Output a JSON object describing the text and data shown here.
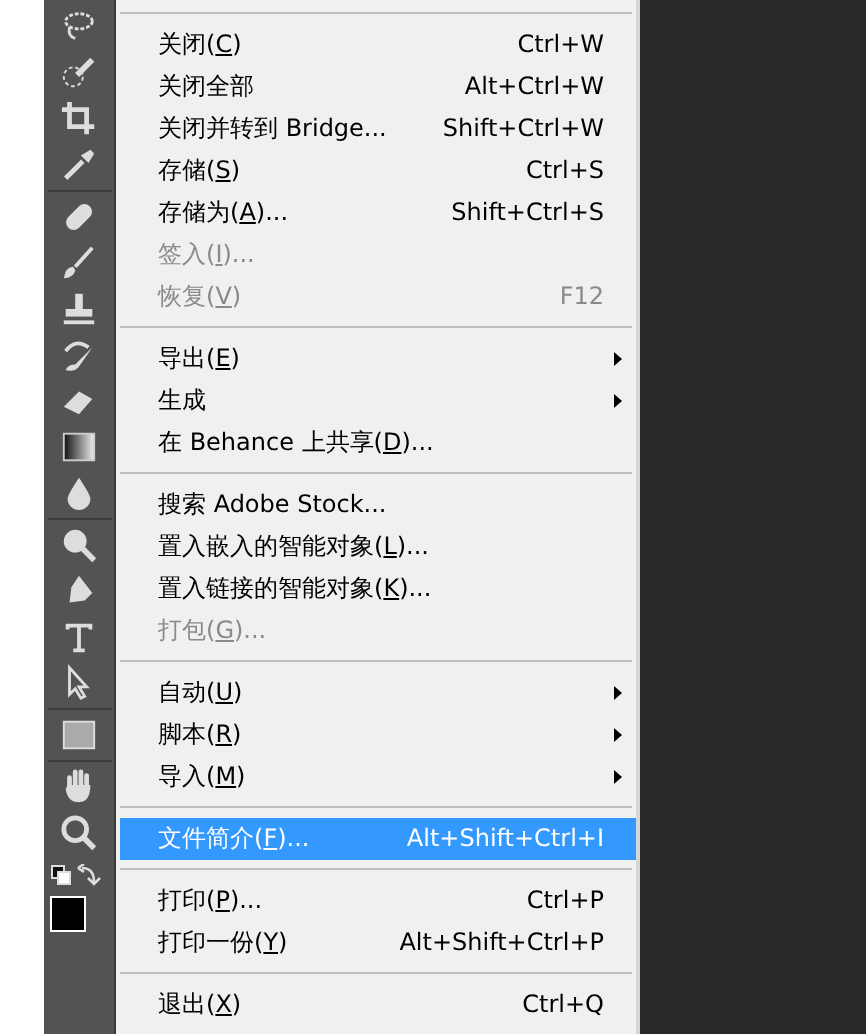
{
  "file_menu": {
    "items": [
      {
        "kind": "separator"
      },
      {
        "kind": "item",
        "parts": [
          "关闭(",
          "C",
          ")"
        ],
        "shortcut": "Ctrl+W",
        "disabled": false,
        "submenu": false,
        "selected": false
      },
      {
        "kind": "item",
        "parts": [
          "关闭全部"
        ],
        "shortcut": "Alt+Ctrl+W",
        "disabled": false,
        "submenu": false,
        "selected": false
      },
      {
        "kind": "item",
        "parts": [
          "关闭并转到 Bridge..."
        ],
        "shortcut": "Shift+Ctrl+W",
        "disabled": false,
        "submenu": false,
        "selected": false
      },
      {
        "kind": "item",
        "parts": [
          "存储(",
          "S",
          ")"
        ],
        "shortcut": "Ctrl+S",
        "disabled": false,
        "submenu": false,
        "selected": false
      },
      {
        "kind": "item",
        "parts": [
          "存储为(",
          "A",
          ")..."
        ],
        "shortcut": "Shift+Ctrl+S",
        "disabled": false,
        "submenu": false,
        "selected": false
      },
      {
        "kind": "item",
        "parts": [
          "签入(",
          "I",
          ")..."
        ],
        "disabled": true,
        "submenu": false,
        "selected": false
      },
      {
        "kind": "item",
        "parts": [
          "恢复(",
          "V",
          ")"
        ],
        "shortcut": "F12",
        "disabled": true,
        "submenu": false,
        "selected": false
      },
      {
        "kind": "separator"
      },
      {
        "kind": "item",
        "parts": [
          "导出(",
          "E",
          ")"
        ],
        "disabled": false,
        "submenu": true,
        "selected": false
      },
      {
        "kind": "item",
        "parts": [
          "生成"
        ],
        "disabled": false,
        "submenu": true,
        "selected": false
      },
      {
        "kind": "item",
        "parts": [
          "在 Behance 上共享(",
          "D",
          ")..."
        ],
        "disabled": false,
        "submenu": false,
        "selected": false
      },
      {
        "kind": "separator"
      },
      {
        "kind": "item",
        "parts": [
          "搜索 Adobe Stock..."
        ],
        "disabled": false,
        "submenu": false,
        "selected": false
      },
      {
        "kind": "item",
        "parts": [
          "置入嵌入的智能对象(",
          "L",
          ")..."
        ],
        "disabled": false,
        "submenu": false,
        "selected": false
      },
      {
        "kind": "item",
        "parts": [
          "置入链接的智能对象(",
          "K",
          ")..."
        ],
        "disabled": false,
        "submenu": false,
        "selected": false
      },
      {
        "kind": "item",
        "parts": [
          "打包(",
          "G",
          ")..."
        ],
        "disabled": true,
        "submenu": false,
        "selected": false
      },
      {
        "kind": "separator"
      },
      {
        "kind": "item",
        "parts": [
          "自动(",
          "U",
          ")"
        ],
        "disabled": false,
        "submenu": true,
        "selected": false
      },
      {
        "kind": "item",
        "parts": [
          "脚本(",
          "R",
          ")"
        ],
        "disabled": false,
        "submenu": true,
        "selected": false
      },
      {
        "kind": "item",
        "parts": [
          "导入(",
          "M",
          ")"
        ],
        "disabled": false,
        "submenu": true,
        "selected": false
      },
      {
        "kind": "separator"
      },
      {
        "kind": "item",
        "parts": [
          "文件简介(",
          "F",
          ")..."
        ],
        "shortcut": "Alt+Shift+Ctrl+I",
        "disabled": false,
        "submenu": false,
        "selected": true
      },
      {
        "kind": "separator"
      },
      {
        "kind": "item",
        "parts": [
          "打印(",
          "P",
          ")..."
        ],
        "shortcut": "Ctrl+P",
        "disabled": false,
        "submenu": false,
        "selected": false
      },
      {
        "kind": "item",
        "parts": [
          "打印一份(",
          "Y",
          ")"
        ],
        "shortcut": "Alt+Shift+Ctrl+P",
        "disabled": false,
        "submenu": false,
        "selected": false
      },
      {
        "kind": "separator"
      },
      {
        "kind": "item",
        "parts": [
          "退出(",
          "X",
          ")"
        ],
        "shortcut": "Ctrl+Q",
        "disabled": false,
        "submenu": false,
        "selected": false
      }
    ]
  }
}
